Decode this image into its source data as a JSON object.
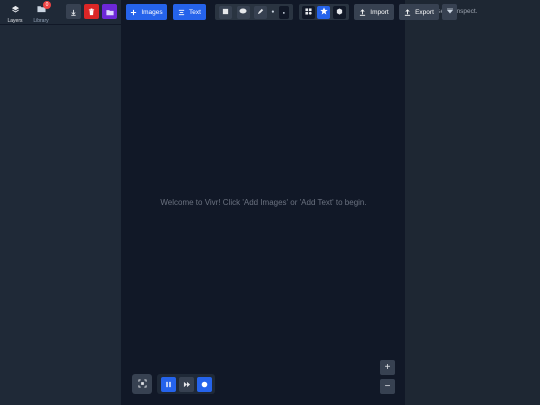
{
  "left_panel": {
    "tabs": [
      {
        "label": "Layers",
        "icon": "layers-icon",
        "active": true
      },
      {
        "label": "Library",
        "icon": "folder-icon",
        "badge": "0"
      }
    ]
  },
  "toolbar": {
    "images_label": "Images",
    "text_label": "Text",
    "import_label": "Import",
    "export_label": "Export"
  },
  "canvas": {
    "welcome_text": "Welcome to Vivr! Click 'Add Images' or 'Add Text' to begin."
  },
  "right_panel": {
    "inspect_hint": "...set to inspect."
  },
  "zoom": {
    "in_label": "+",
    "out_label": "−"
  },
  "colors": {
    "accent": "#2563eb",
    "danger": "#dc2626",
    "purple": "#6d28d9",
    "canvas": "#111827"
  }
}
